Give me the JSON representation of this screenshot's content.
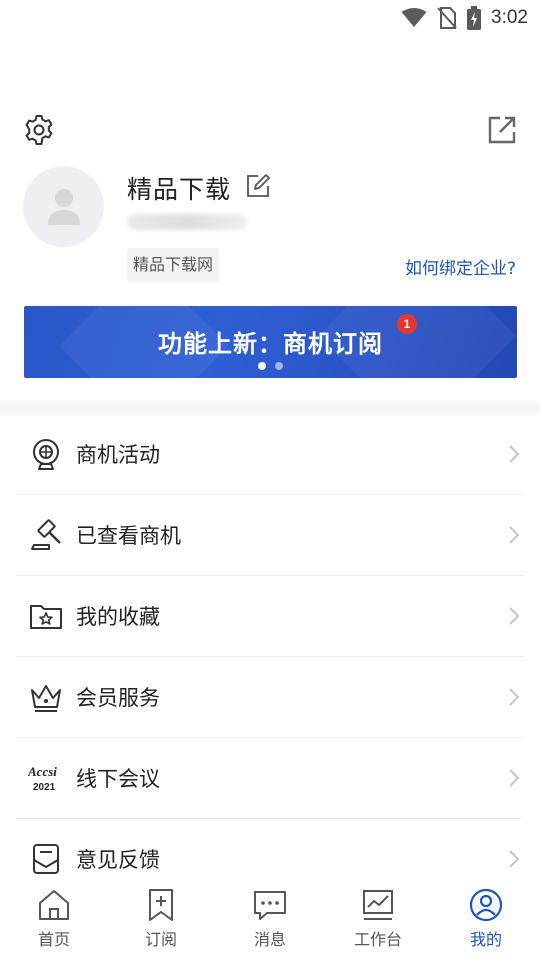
{
  "status_bar": {
    "time": "3:02",
    "icons": [
      "wifi-icon",
      "no-sim-icon",
      "battery-charging-icon"
    ]
  },
  "header": {
    "settings_icon": "gear-icon",
    "share_icon": "external-link-icon"
  },
  "profile": {
    "username": "精品下载",
    "company_tag": "精品下载网",
    "bind_link": "如何绑定企业?"
  },
  "banner": {
    "title": "功能上新：商机订阅",
    "badge_count": "1",
    "slides": 2,
    "active_slide": 1,
    "colors": {
      "background": "#2a56c8",
      "badge": "#e5362f"
    }
  },
  "menu": {
    "items": [
      {
        "label": "商机活动",
        "icon": "globe-trophy-icon"
      },
      {
        "label": "已查看商机",
        "icon": "gavel-icon"
      },
      {
        "label": "我的收藏",
        "icon": "folder-star-icon"
      },
      {
        "label": "会员服务",
        "icon": "crown-icon"
      },
      {
        "label": "线下会议",
        "icon": "accsi-2021-logo-icon",
        "logo_text": "Accsi 2021"
      },
      {
        "label": "意见反馈",
        "icon": "feedback-icon"
      }
    ]
  },
  "tabbar": {
    "tabs": [
      {
        "label": "首页",
        "icon": "home-icon"
      },
      {
        "label": "订阅",
        "icon": "bookmark-plus-icon"
      },
      {
        "label": "消息",
        "icon": "chat-icon"
      },
      {
        "label": "工作台",
        "icon": "monitor-chart-icon"
      },
      {
        "label": "我的",
        "icon": "user-icon",
        "active": true
      }
    ],
    "active_color": "#1d56b8"
  }
}
